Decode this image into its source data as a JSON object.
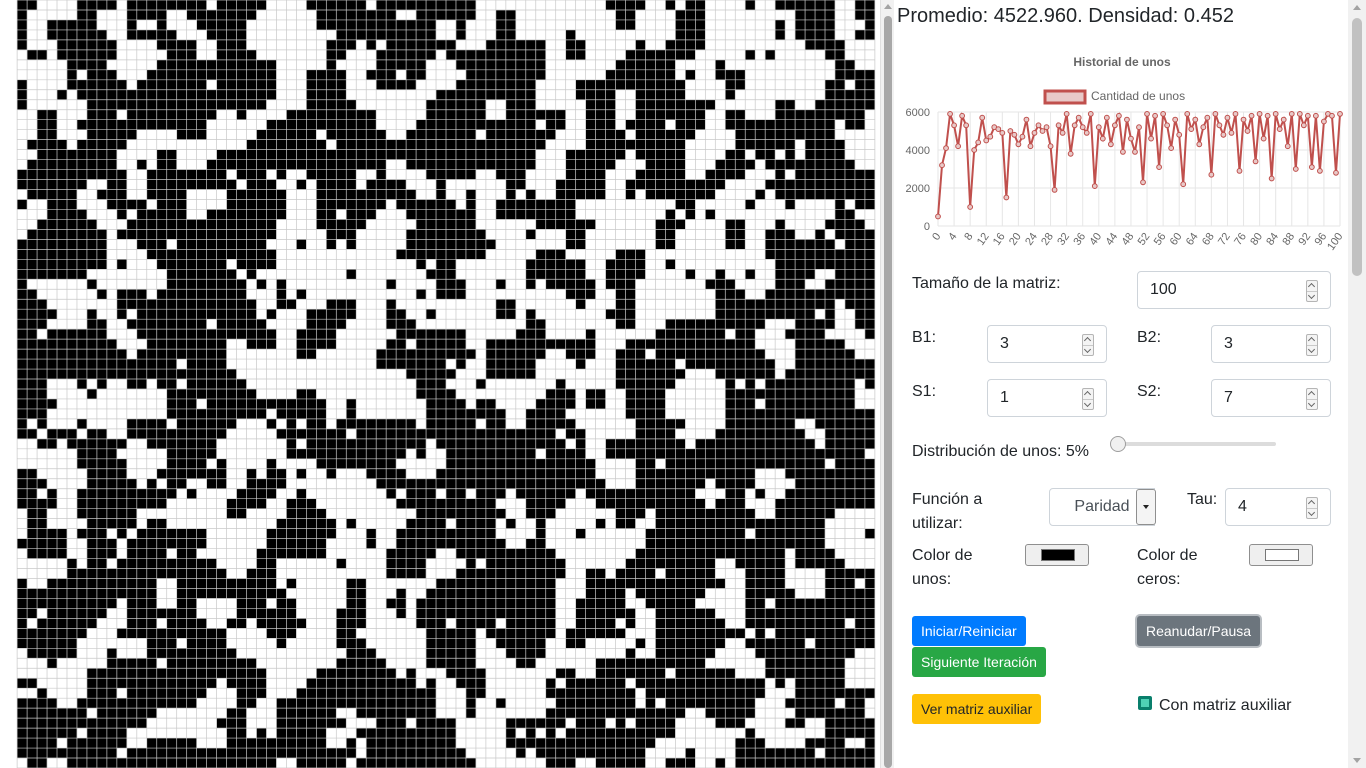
{
  "stats": {
    "promedio_label": "Promedio:",
    "promedio_value": "4522.960.",
    "densidad_label": "Densidad:",
    "densidad_value": "0.452"
  },
  "chart_data": {
    "type": "line",
    "title": "Historial de unos",
    "series": [
      {
        "name": "Cantidad de unos",
        "color": "#c0504d",
        "values": [
          500,
          3200,
          4100,
          5900,
          5300,
          4200,
          5800,
          5300,
          1000,
          4000,
          4400,
          5700,
          4500,
          4700,
          5200,
          5100,
          4900,
          1500,
          5000,
          4800,
          4300,
          4700,
          5600,
          4200,
          4900,
          5300,
          5000,
          5200,
          4200,
          1900,
          5300,
          4900,
          5900,
          3800,
          5300,
          5700,
          5200,
          4900,
          5900,
          2100,
          5200,
          4600,
          5700,
          4300,
          5300,
          5800,
          3900,
          5600,
          4600,
          3900,
          5200,
          2300,
          5900,
          4600,
          5800,
          3100,
          5900,
          5300,
          4100,
          5600,
          4800,
          2200,
          5900,
          5100,
          5600,
          4300,
          5200,
          5700,
          2700,
          5900,
          5300,
          4800,
          5700,
          4900,
          5900,
          2900,
          5600,
          5000,
          5800,
          3400,
          5900,
          4600,
          5800,
          2500,
          5900,
          5100,
          5600,
          4200,
          5900,
          3000,
          5900,
          5300,
          5800,
          3100,
          5800,
          2900,
          5500,
          5900,
          5800,
          2800,
          5900
        ]
      }
    ],
    "x_ticks": [
      "0",
      "4",
      "8",
      "12",
      "16",
      "20",
      "24",
      "28",
      "32",
      "36",
      "40",
      "44",
      "48",
      "52",
      "56",
      "60",
      "64",
      "68",
      "72",
      "76",
      "80",
      "84",
      "88",
      "92",
      "96",
      "100"
    ],
    "y_ticks": [
      "0",
      "2000",
      "4000",
      "6000"
    ],
    "ylim": [
      0,
      6000
    ],
    "xlim": [
      0,
      100
    ],
    "legend_position": "top",
    "grid": true
  },
  "controls": {
    "tamano_label": "Tamaño de la matriz:",
    "tamano_value": "100",
    "b1_label": "B1:",
    "b1_value": "3",
    "b2_label": "B2:",
    "b2_value": "3",
    "s1_label": "S1:",
    "s1_value": "1",
    "s2_label": "S2:",
    "s2_value": "7",
    "distribucion_label": "Distribución de unos: 5%",
    "distribucion_level": 0.0,
    "funcion_label": "Función a utilizar:",
    "funcion_value": "Paridad",
    "tau_label": "Tau:",
    "tau_value": "4",
    "color_unos_label": "Color de unos:",
    "color_unos": "#000000",
    "color_ceros_label": "Color de ceros:",
    "color_ceros": "#ffffff"
  },
  "buttons": {
    "iniciar": "Iniciar/Reiniciar",
    "reanudar": "Reanudar/Pausa",
    "siguiente": "Siguiente Iteración",
    "ver_matriz": "Ver matriz auxiliar",
    "con_matriz": "Con matriz auxiliar"
  },
  "grid": {
    "size": 100,
    "visible_cols": 86,
    "visible_rows": 77,
    "one_color": "#000000",
    "zero_color": "#ffffff",
    "line_color": "#c8c8c8",
    "density": 0.452
  }
}
